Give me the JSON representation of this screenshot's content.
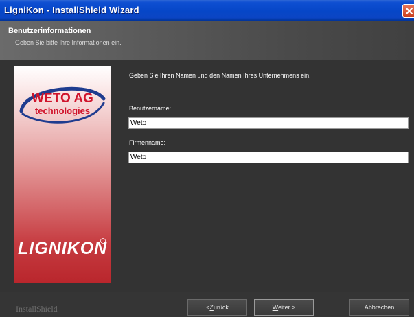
{
  "window": {
    "title": "LigniKon - InstallShield Wizard"
  },
  "header": {
    "title": "Benutzerinformationen",
    "subtitle": "Geben Sie bitte Ihre Informationen ein."
  },
  "side_image": {
    "logo_line1": "WETO AG",
    "logo_line2": "technologies",
    "product_logo": "LIGNIKON"
  },
  "form": {
    "instructions": "Geben Sie Ihren Namen und den Namen Ihres Unternehmens ein.",
    "username_label": "Benutzername:",
    "username_value": "Weto",
    "company_label": "Firmenname:",
    "company_value": "Weto"
  },
  "footer": {
    "brand": "InstallShield",
    "back_prefix": "< ",
    "back_hotkey": "Z",
    "back_rest": "urück",
    "next_hotkey": "W",
    "next_rest": "eiter >",
    "cancel_label": "Abbrechen"
  },
  "colors": {
    "titlebar": "#0646c7",
    "background": "#333333",
    "input_bg": "#ffffff",
    "logo_blue": "#1f3c8f",
    "logo_red": "#d0142c"
  },
  "icons": {
    "close": "close-icon"
  }
}
